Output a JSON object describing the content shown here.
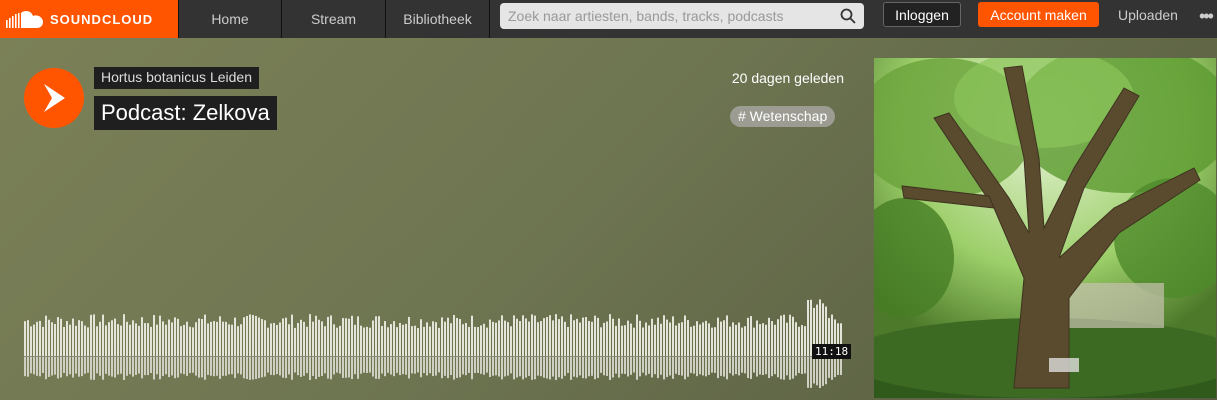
{
  "header": {
    "logo_text": "SOUNDCLOUD",
    "nav": [
      "Home",
      "Stream",
      "Bibliotheek"
    ],
    "search_placeholder": "Zoek naar artiesten, bands, tracks, podcasts",
    "login_label": "Inloggen",
    "signup_label": "Account maken",
    "upload_label": "Uploaden",
    "more_icon": "•••",
    "accent_color": "#ff5500"
  },
  "track": {
    "artist": "Hortus botanicus Leiden",
    "title": "Podcast: Zelkova",
    "posted": "20 dagen geleden",
    "tag": "# Wetenschap",
    "duration": "11:18",
    "played_fraction": 0
  }
}
